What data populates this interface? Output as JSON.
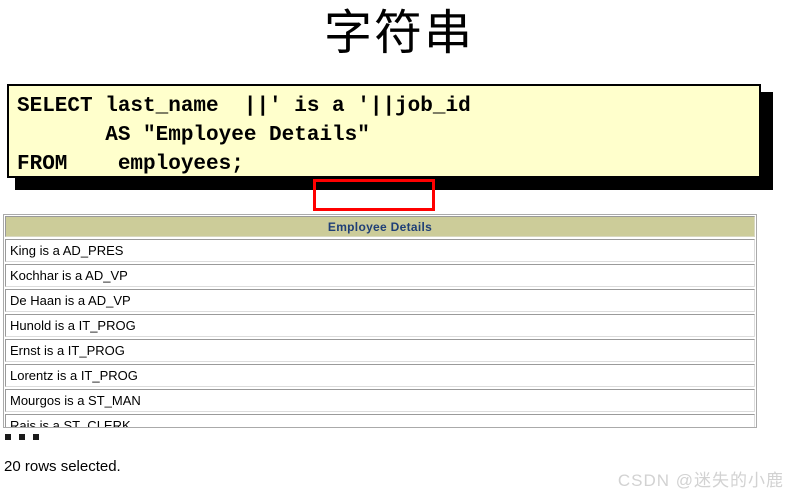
{
  "slide": {
    "title": "字符串"
  },
  "code_block": {
    "sql": "SELECT last_name  ||' is a '||job_id\n       AS \"Employee Details\"\nFROM    employees;",
    "highlight_text": "' is a '",
    "highlight_color": "#ff0000",
    "background_color": "#ffffcc",
    "border_color": "#000000"
  },
  "result": {
    "header": "Employee Details",
    "header_background": "#cccc99",
    "header_text_color": "#1f3f77",
    "rows": [
      "King is a AD_PRES",
      "Kochhar is a AD_VP",
      "De Haan is a AD_VP",
      "Hunold is a IT_PROG",
      "Ernst is a IT_PROG",
      "Lorentz is a IT_PROG",
      "Mourgos is a ST_MAN",
      "Rajs is a ST_CLERK",
      ""
    ],
    "ellipsis": "...",
    "status": "20 rows selected."
  },
  "watermark": {
    "text": "CSDN @迷失的小鹿"
  }
}
